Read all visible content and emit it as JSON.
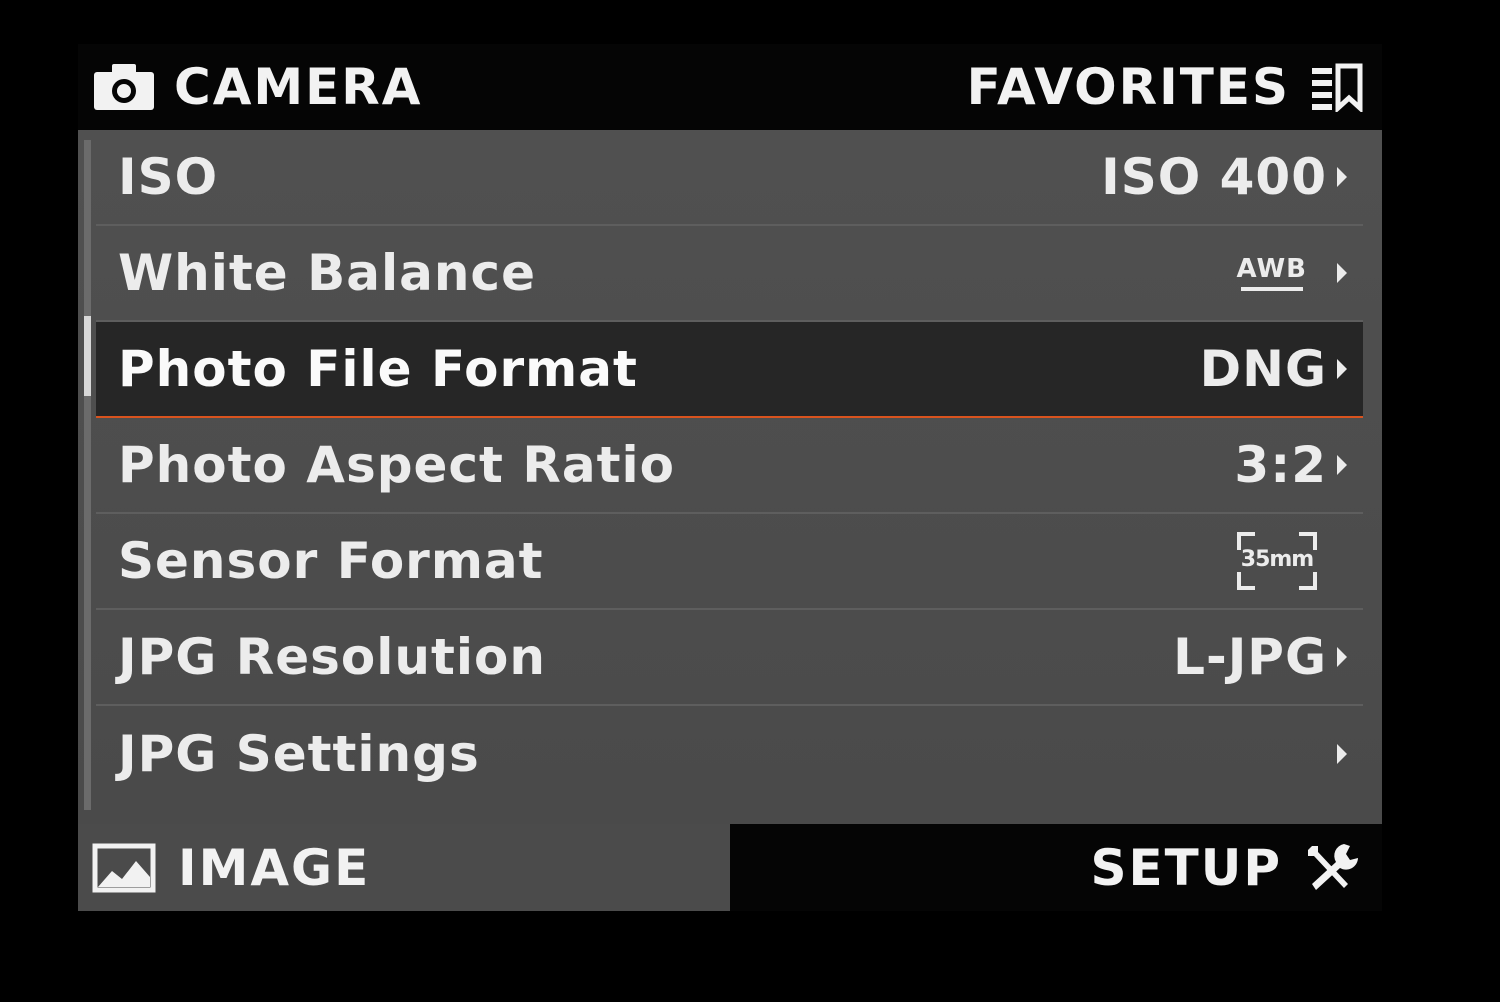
{
  "top_bar": {
    "left_tab": {
      "label": "CAMERA",
      "icon": "camera-icon"
    },
    "right_tab": {
      "label": "FAVORITES",
      "icon": "favorites-list-icon"
    }
  },
  "menu": {
    "items": [
      {
        "label": "ISO",
        "value": "ISO 400",
        "has_chevron": true
      },
      {
        "label": "White Balance",
        "value_icon": "awb-icon",
        "value_icon_text": "AWB",
        "has_chevron": true
      },
      {
        "label": "Photo File Format",
        "value": "DNG",
        "has_chevron": true,
        "selected": true
      },
      {
        "label": "Photo Aspect Ratio",
        "value": "3:2",
        "has_chevron": true
      },
      {
        "label": "Sensor Format",
        "value_icon": "sensor-35mm-icon",
        "value_icon_text": "35mm",
        "has_chevron": false
      },
      {
        "label": "JPG Resolution",
        "value": "L-JPG",
        "has_chevron": true
      },
      {
        "label": "JPG Settings",
        "value": "",
        "has_chevron": true
      }
    ]
  },
  "bottom_bar": {
    "left_tab": {
      "label": "IMAGE",
      "icon": "image-icon"
    },
    "right_tab": {
      "label": "SETUP",
      "icon": "wrench-screwdriver-icon"
    }
  },
  "colors": {
    "background": "#000000",
    "panel": "#4e4e4e",
    "selected_row": "#262626",
    "accent": "#d9531e",
    "text": "#ececec"
  }
}
